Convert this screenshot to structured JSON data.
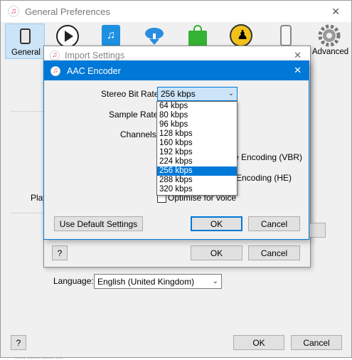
{
  "prefs_window": {
    "title": "General Preferences",
    "close_glyph": "✕",
    "toolbar": [
      {
        "label": "General",
        "icon": "phone-icon"
      },
      {
        "label": "",
        "icon": "play-icon"
      },
      {
        "label": "",
        "icon": "music-library-icon"
      },
      {
        "label": "",
        "icon": "cloud-download-icon"
      },
      {
        "label": "",
        "icon": "store-bag-icon"
      },
      {
        "label": "",
        "icon": "parental-icon"
      },
      {
        "label": "",
        "icon": "device-icon"
      },
      {
        "label": "Advanced",
        "icon": "gear-icon"
      }
    ],
    "partial_label": "Play",
    "language_label": "Language:",
    "language_value": "English (United Kingdom)",
    "help_label": "?",
    "ok_label": "OK",
    "cancel_label": "Cancel",
    "bottom_partial_text": "......  .......  .......  ...."
  },
  "import_window": {
    "title": "Import Settings",
    "close_glyph": "✕",
    "help_label": "?",
    "ok_label": "OK",
    "cancel_label": "Cancel"
  },
  "aac_dialog": {
    "title": "AAC Encoder",
    "close_glyph": "✕",
    "stereo_bit_rate_label": "Stereo Bit Rate:",
    "stereo_bit_rate_value": "256 kbps",
    "sample_rate_label": "Sample Rate:",
    "channels_label": "Channels:",
    "vbr_label": "e Encoding (VBR)",
    "he_label": "Encoding (HE)",
    "optimise_label": "Optimise for voice",
    "use_default_label": "Use Default Settings",
    "ok_label": "OK",
    "cancel_label": "Cancel",
    "bitrate_options": [
      "64 kbps",
      "80 kbps",
      "96 kbps",
      "128 kbps",
      "160 kbps",
      "192 kbps",
      "224 kbps",
      "256 kbps",
      "288 kbps",
      "320 kbps"
    ],
    "selected_option": "256 kbps"
  },
  "colors": {
    "accent": "#0078d7",
    "toolbar_selected": "#cce4f7"
  }
}
